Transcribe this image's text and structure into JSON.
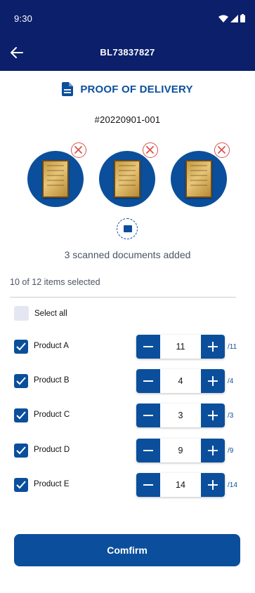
{
  "status_bar": {
    "time": "9:30",
    "icons": [
      "wifi-icon",
      "signal-icon",
      "battery-icon"
    ]
  },
  "app_bar": {
    "title": "BL73837827",
    "back_icon": "arrow-left-icon"
  },
  "header": {
    "title": "PROOF OF DELIVERY",
    "icon": "document-icon"
  },
  "order_number": "#20220901-001",
  "documents": {
    "count": 3,
    "remove_icon": "close-circle-icon"
  },
  "scan_added_text": "3 scanned documents added",
  "selection_summary": "10 of 12 items selected",
  "select_all_label": "Select all",
  "products": [
    {
      "name": "Product A",
      "quantity": "11",
      "max": "/11",
      "checked": true
    },
    {
      "name": "Product B",
      "quantity": "4",
      "max": "/4",
      "checked": true
    },
    {
      "name": "Product C",
      "quantity": "3",
      "max": "/3",
      "checked": true
    },
    {
      "name": "Product D",
      "quantity": "9",
      "max": "/9",
      "checked": true
    },
    {
      "name": "Product E",
      "quantity": "14",
      "max": "/14",
      "checked": true
    }
  ],
  "confirm_label": "Comfirm",
  "colors": {
    "primary": "#0b4f9c",
    "appbar": "#0b1f6b",
    "danger": "#d9534f"
  }
}
